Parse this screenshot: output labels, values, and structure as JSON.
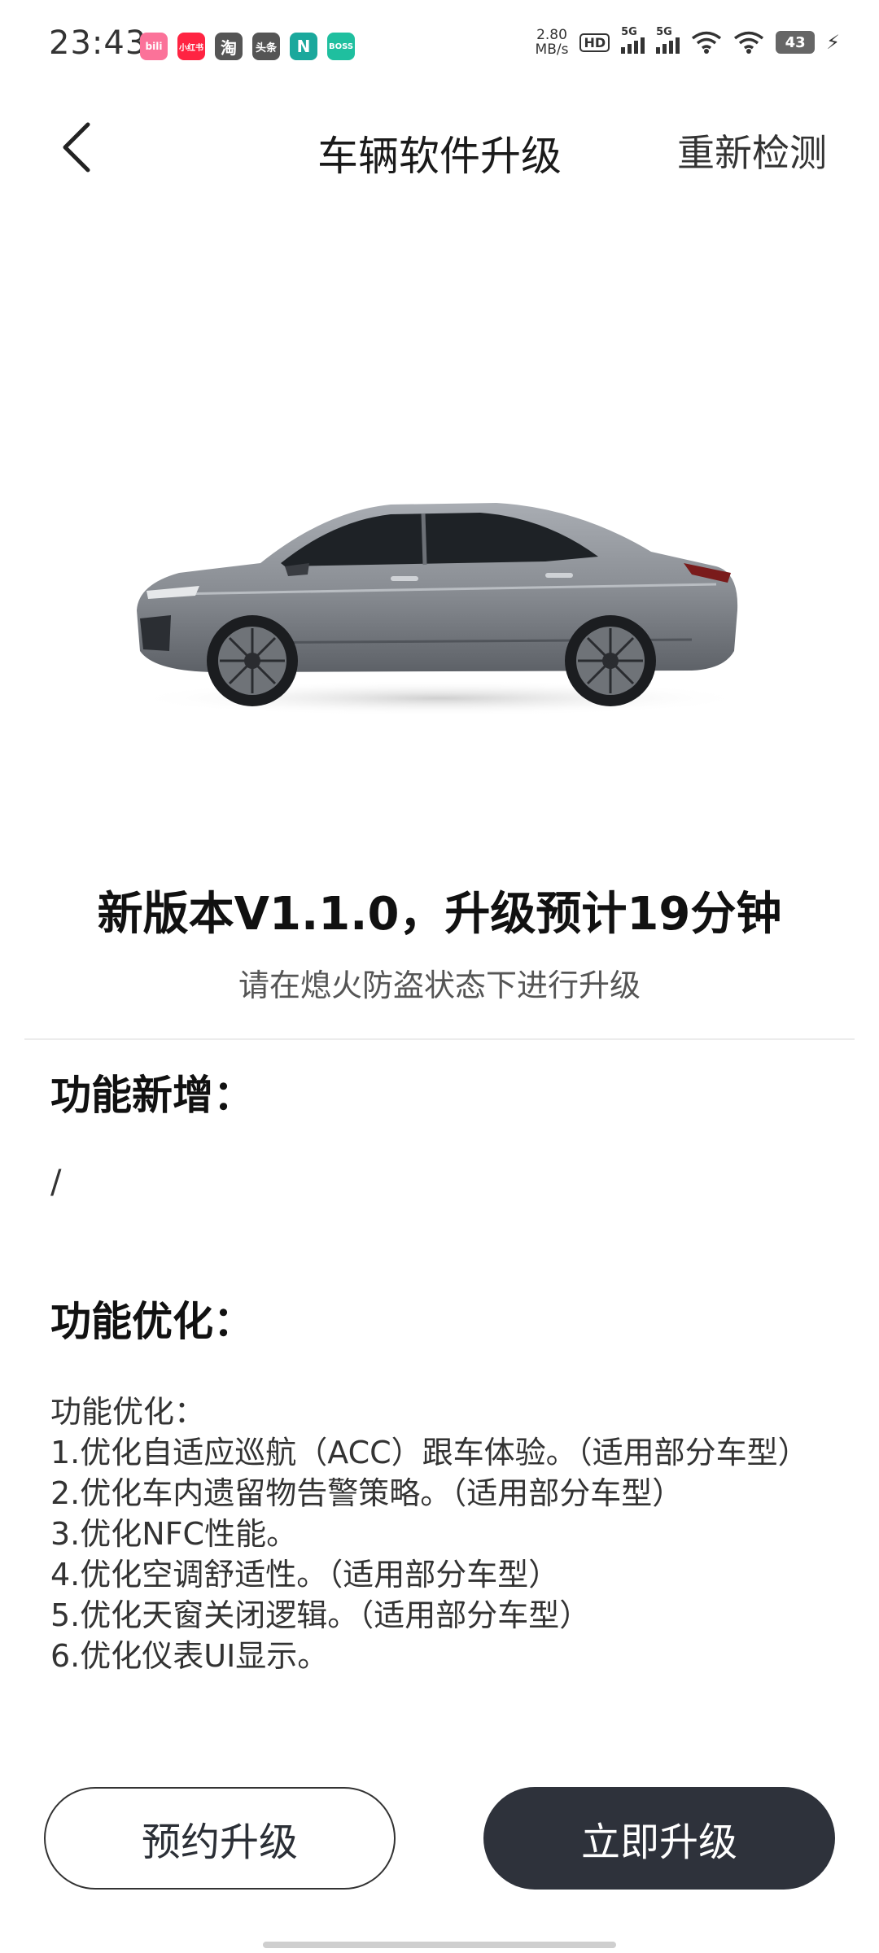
{
  "status_bar": {
    "time": "23:43",
    "app_icons": [
      {
        "name": "bilibili-icon",
        "text": "bili",
        "color": "#fb7299"
      },
      {
        "name": "xiaohongshu-icon",
        "text": "小红书",
        "color": "#ff2442"
      },
      {
        "name": "taobao-icon",
        "text": "淘",
        "color": "#555555"
      },
      {
        "name": "toutiao-icon",
        "text": "头条",
        "color": "#555555"
      },
      {
        "name": "nio-icon",
        "text": "N",
        "color": "#1aa89c"
      },
      {
        "name": "boss-icon",
        "text": "BOSS",
        "color": "#1fbf9f"
      }
    ],
    "net_speed_value": "2.80",
    "net_speed_unit": "MB/s",
    "hd_label": "HD",
    "sim1_label": "5G",
    "sim2_label": "5G",
    "battery": "43"
  },
  "header": {
    "back_icon": "chevron-left-icon",
    "title": "车辆软件升级",
    "recheck_label": "重新检测"
  },
  "update": {
    "version_title": "新版本V1.1.0，升级预计19分钟",
    "note": "请在熄火防盗状态下进行升级"
  },
  "sections": {
    "new_features_title": "功能新增：",
    "new_features_body": "/",
    "optimizations_title": "功能优化：",
    "optimization_lines": [
      "功能优化：",
      "1.优化自适应巡航（ACC）跟车体验。（适用部分车型）",
      "2.优化车内遗留物告警策略。（适用部分车型）",
      "3.优化NFC性能。",
      "4.优化空调舒适性。（适用部分车型）",
      "5.优化天窗关闭逻辑。（适用部分车型）",
      "6.优化仪表UI显示。"
    ]
  },
  "buttons": {
    "reserve_label": "预约升级",
    "upgrade_now_label": "立即升级"
  },
  "colors": {
    "primary_button": "#2e323b",
    "car_body": "#8d9197"
  }
}
